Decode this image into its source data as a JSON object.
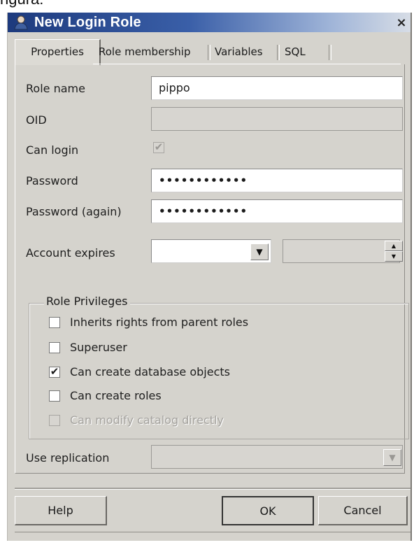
{
  "page_fragment": "ngura:",
  "window": {
    "title": "New Login Role",
    "close_glyph": "×"
  },
  "tabs": [
    {
      "label": "Properties",
      "active": true
    },
    {
      "label": "Role membership",
      "active": false
    },
    {
      "label": "Variables",
      "active": false
    },
    {
      "label": "SQL",
      "active": false
    }
  ],
  "properties": {
    "role_name_label": "Role name",
    "role_name_value": "pippo",
    "oid_label": "OID",
    "oid_value": "",
    "can_login_label": "Can login",
    "can_login_checked": true,
    "password_label": "Password",
    "password_value": "••••••••••••",
    "password_again_label": "Password (again)",
    "password_again_value": "••••••••••••",
    "account_expires_label": "Account expires",
    "account_expires_date": "",
    "account_expires_time": ""
  },
  "privileges": {
    "group_label": "Role Privileges",
    "inherits_label": "Inherits rights from parent roles",
    "inherits_checked": false,
    "superuser_label": "Superuser",
    "superuser_checked": false,
    "create_db_label": "Can create database objects",
    "create_db_checked": true,
    "create_roles_label": "Can create roles",
    "create_roles_checked": false,
    "modify_catalog_label": "Can modify catalog directly",
    "modify_catalog_checked": false
  },
  "replication": {
    "label": "Use replication",
    "value": ""
  },
  "buttons": {
    "help": "Help",
    "ok": "OK",
    "cancel": "Cancel"
  },
  "glyphs": {
    "check": "✔",
    "dropdown": "▼",
    "spin_up": "▲",
    "spin_down": "▼"
  },
  "icons": {
    "title_icon": "user-icon"
  },
  "colors": {
    "title_start": "#1d3a7d",
    "title_end": "#d7dde6",
    "dialog_bg": "#d5d3cd"
  }
}
